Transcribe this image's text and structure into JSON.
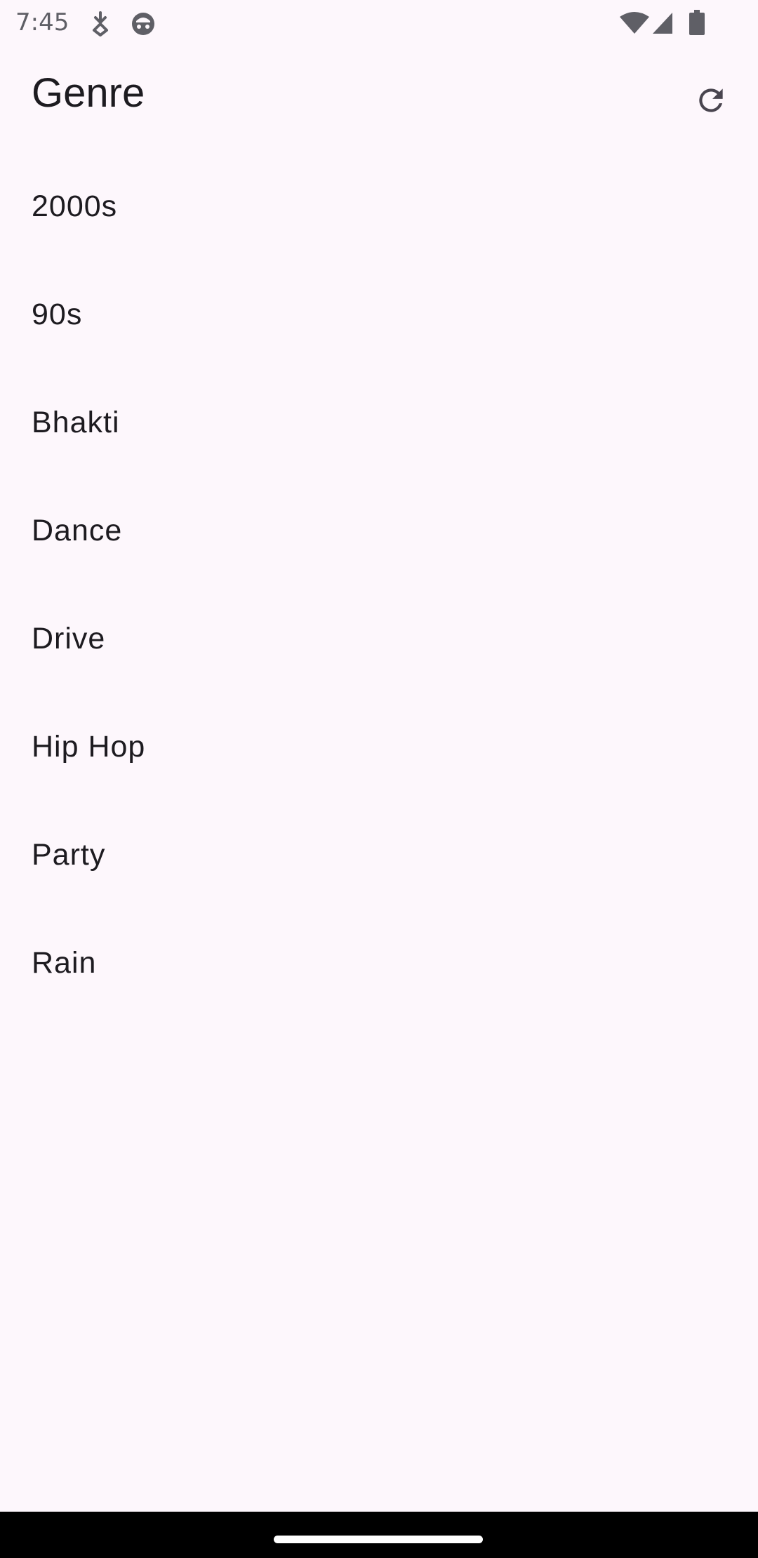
{
  "status_bar": {
    "time": "7:45",
    "icons": [
      "download-notification-icon",
      "face-notification-icon",
      "wifi-icon",
      "cellular-signal-icon",
      "battery-icon"
    ]
  },
  "header": {
    "title": "Genre",
    "refresh_icon": "refresh-icon"
  },
  "genres": [
    {
      "label": "2000s"
    },
    {
      "label": "90s"
    },
    {
      "label": "Bhakti"
    },
    {
      "label": "Dance"
    },
    {
      "label": "Drive"
    },
    {
      "label": "Hip Hop"
    },
    {
      "label": "Party"
    },
    {
      "label": "Rain"
    }
  ],
  "colors": {
    "background": "#FDF7FC",
    "text": "#1D1B20",
    "status_icon": "#5F5F66",
    "nav_bar": "#000000"
  }
}
